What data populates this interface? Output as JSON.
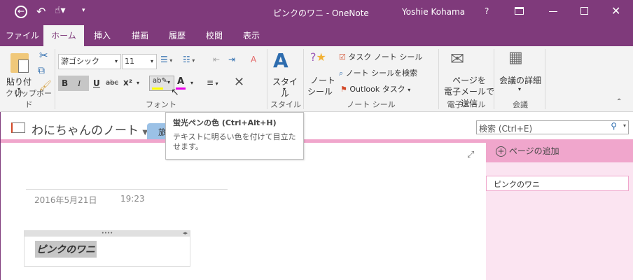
{
  "titlebar": {
    "title": "ピンクのワニ - OneNote",
    "user": "Yoshie Kohama",
    "help": "?",
    "icons": [
      "back-icon",
      "undo-icon",
      "touch-mode-icon",
      "customize-qat-icon",
      "ribbon-display-icon",
      "minimize-icon",
      "maximize-icon",
      "close-icon"
    ]
  },
  "tabs": [
    "ファイル",
    "ホーム",
    "挿入",
    "描画",
    "履歴",
    "校閲",
    "表示"
  ],
  "ribbon": {
    "clipboard": {
      "paste": "貼り付け",
      "group": "クリップボード"
    },
    "font": {
      "font_name": "游ゴシック",
      "font_size": "11",
      "bold": "B",
      "italic": "I",
      "underline": "U",
      "strike": "abc",
      "superscript": "x²",
      "highlight_color": "#ffff00",
      "font_color": "#e800e8",
      "group": "フォント"
    },
    "styles": {
      "label": "スタイル",
      "group": "スタイル"
    },
    "tags": {
      "note_tag_line1": "ノート",
      "note_tag_line2": "シール",
      "todo": "タスク ノート シール",
      "find": "ノート シールを検索",
      "outlook": "Outlook タスク",
      "group": "ノート シール"
    },
    "email": {
      "line1": "ページを",
      "line2": "電子メールで送信",
      "group": "電子メール"
    },
    "meetings": {
      "label": "会議の詳細",
      "group": "会議"
    }
  },
  "tooltip": {
    "title": "蛍光ペンの色 (Ctrl+Alt+H)",
    "body": "テキストに明るい色を付けて目立たせます。"
  },
  "notebook": {
    "name": "わにちゃんのノート",
    "section": "旅"
  },
  "search": {
    "placeholder": "検索 (Ctrl+E)"
  },
  "page": {
    "date": "2016年5月21日",
    "time": "19:23",
    "note_text": "ピンクのワニ"
  },
  "pages_pane": {
    "add_page": "ページの追加",
    "pages": [
      "ピンクのワニ"
    ]
  },
  "colors": {
    "accent": "#7f3a7b",
    "section_pink": "#f0a6cc",
    "pane_bg": "#fbe4f1"
  }
}
